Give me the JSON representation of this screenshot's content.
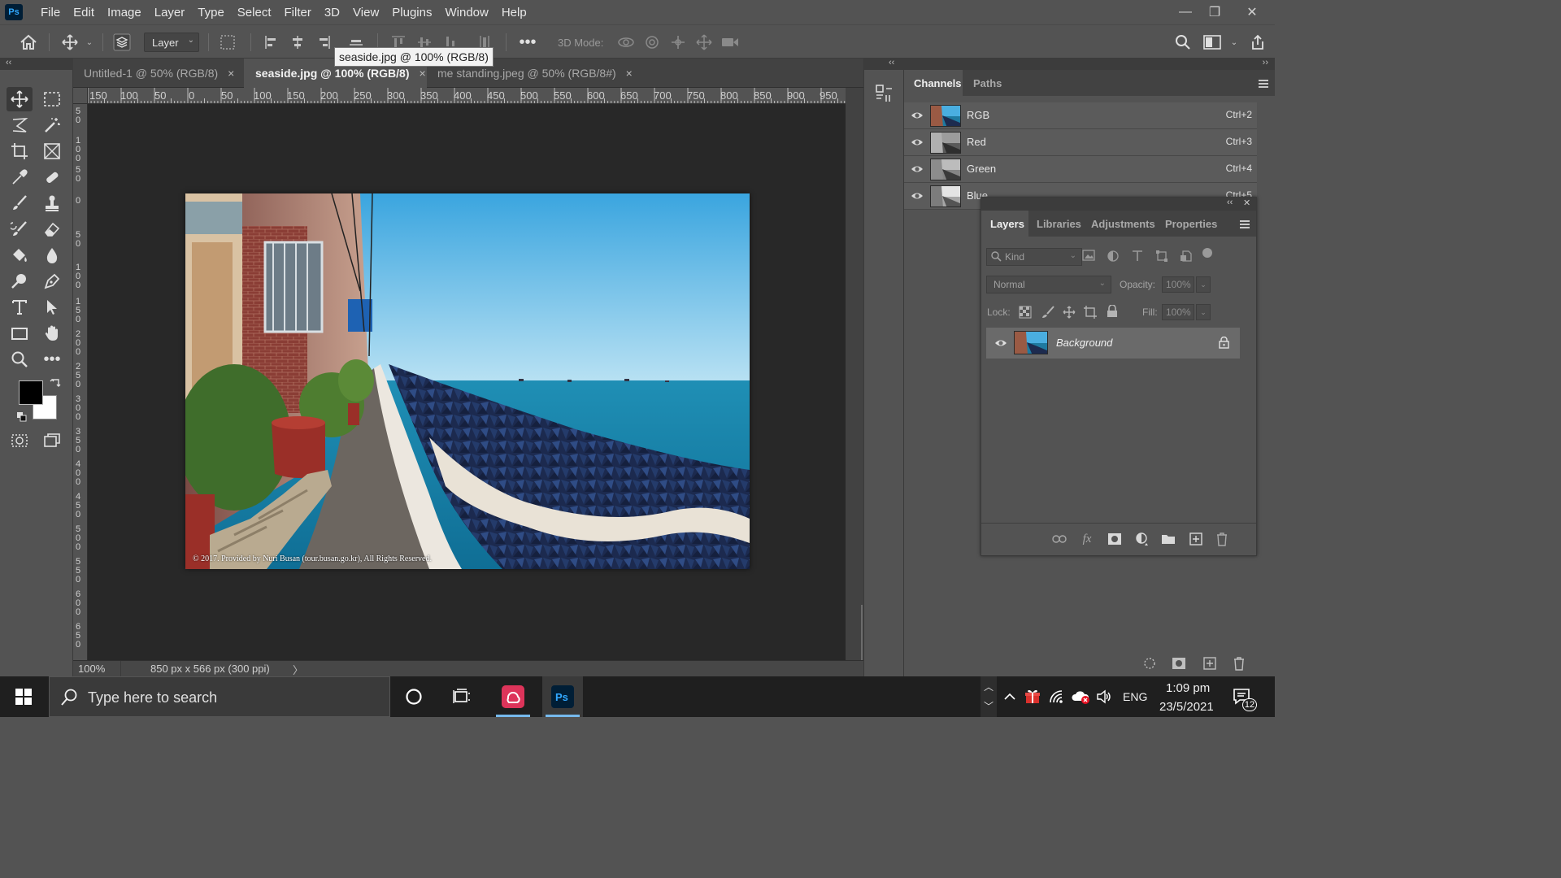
{
  "app": {
    "logo_text": "Ps"
  },
  "menu": [
    "File",
    "Edit",
    "Image",
    "Layer",
    "Type",
    "Select",
    "Filter",
    "3D",
    "View",
    "Plugins",
    "Window",
    "Help"
  ],
  "window_controls": {
    "minimize": "—",
    "restore": "❐",
    "close": "✕"
  },
  "options_bar": {
    "layer_select_value": "Layer",
    "three_d_mode_label": "3D Mode:"
  },
  "tabs": [
    {
      "label": "Untitled-1 @ 50% (RGB/8)",
      "active": false
    },
    {
      "label": "seaside.jpg @ 100% (RGB/8)",
      "active": true
    },
    {
      "label": "me standing.jpeg @ 50% (RGB/8#)",
      "active": false
    }
  ],
  "tab_close_glyph": "×",
  "tooltip": "seaside.jpg @ 100% (RGB/8)",
  "ruler_top_labels": [
    "150",
    "100",
    "50",
    "0",
    "50",
    "100",
    "150",
    "200",
    "250",
    "300",
    "350",
    "400",
    "450",
    "500",
    "550",
    "600",
    "650",
    "700",
    "750",
    "800",
    "850",
    "900",
    "950"
  ],
  "ruler_left_labels": [
    "50",
    "100",
    "50",
    "0",
    "50",
    "100",
    "150",
    "200",
    "250",
    "300",
    "350",
    "400",
    "450",
    "500",
    "550",
    "600",
    "650"
  ],
  "image": {
    "copyright": "© 2017. Provided by Nuri Busan (tour.busan.go.kr), All Rights Reserved."
  },
  "status": {
    "zoom": "100%",
    "doc_info": "850 px x 566 px (300 ppi)",
    "more_glyph": "〉"
  },
  "channels_panel": {
    "tabs": [
      "Channels",
      "Paths"
    ],
    "channels": [
      {
        "name": "RGB",
        "shortcut": "Ctrl+2"
      },
      {
        "name": "Red",
        "shortcut": "Ctrl+3"
      },
      {
        "name": "Green",
        "shortcut": "Ctrl+4"
      },
      {
        "name": "Blue",
        "shortcut": "Ctrl+5"
      }
    ]
  },
  "layers_panel": {
    "tabs": [
      "Layers",
      "Libraries",
      "Adjustments",
      "Properties"
    ],
    "kind_placeholder": "Kind",
    "blend_mode": "Normal",
    "opacity_label": "Opacity:",
    "opacity_value": "100%",
    "lock_label": "Lock:",
    "fill_label": "Fill:",
    "fill_value": "100%",
    "layers": [
      {
        "name": "Background",
        "locked": true
      }
    ]
  },
  "dock_glyphs": {
    "collapse_left": "‹‹",
    "collapse_right": "››",
    "panel_collapse": "‹‹",
    "panel_close": "✕"
  },
  "taskbar": {
    "search_placeholder": "Type here to search",
    "language": "ENG",
    "time": "1:09 pm",
    "date": "23/5/2021",
    "notification_count": "12"
  },
  "colors": {
    "ps_blue": "#31a8ff",
    "ps_dark": "#001e36",
    "panel": "#535353",
    "canvas": "#282828",
    "taskbar_accent": "#76b9ed"
  }
}
